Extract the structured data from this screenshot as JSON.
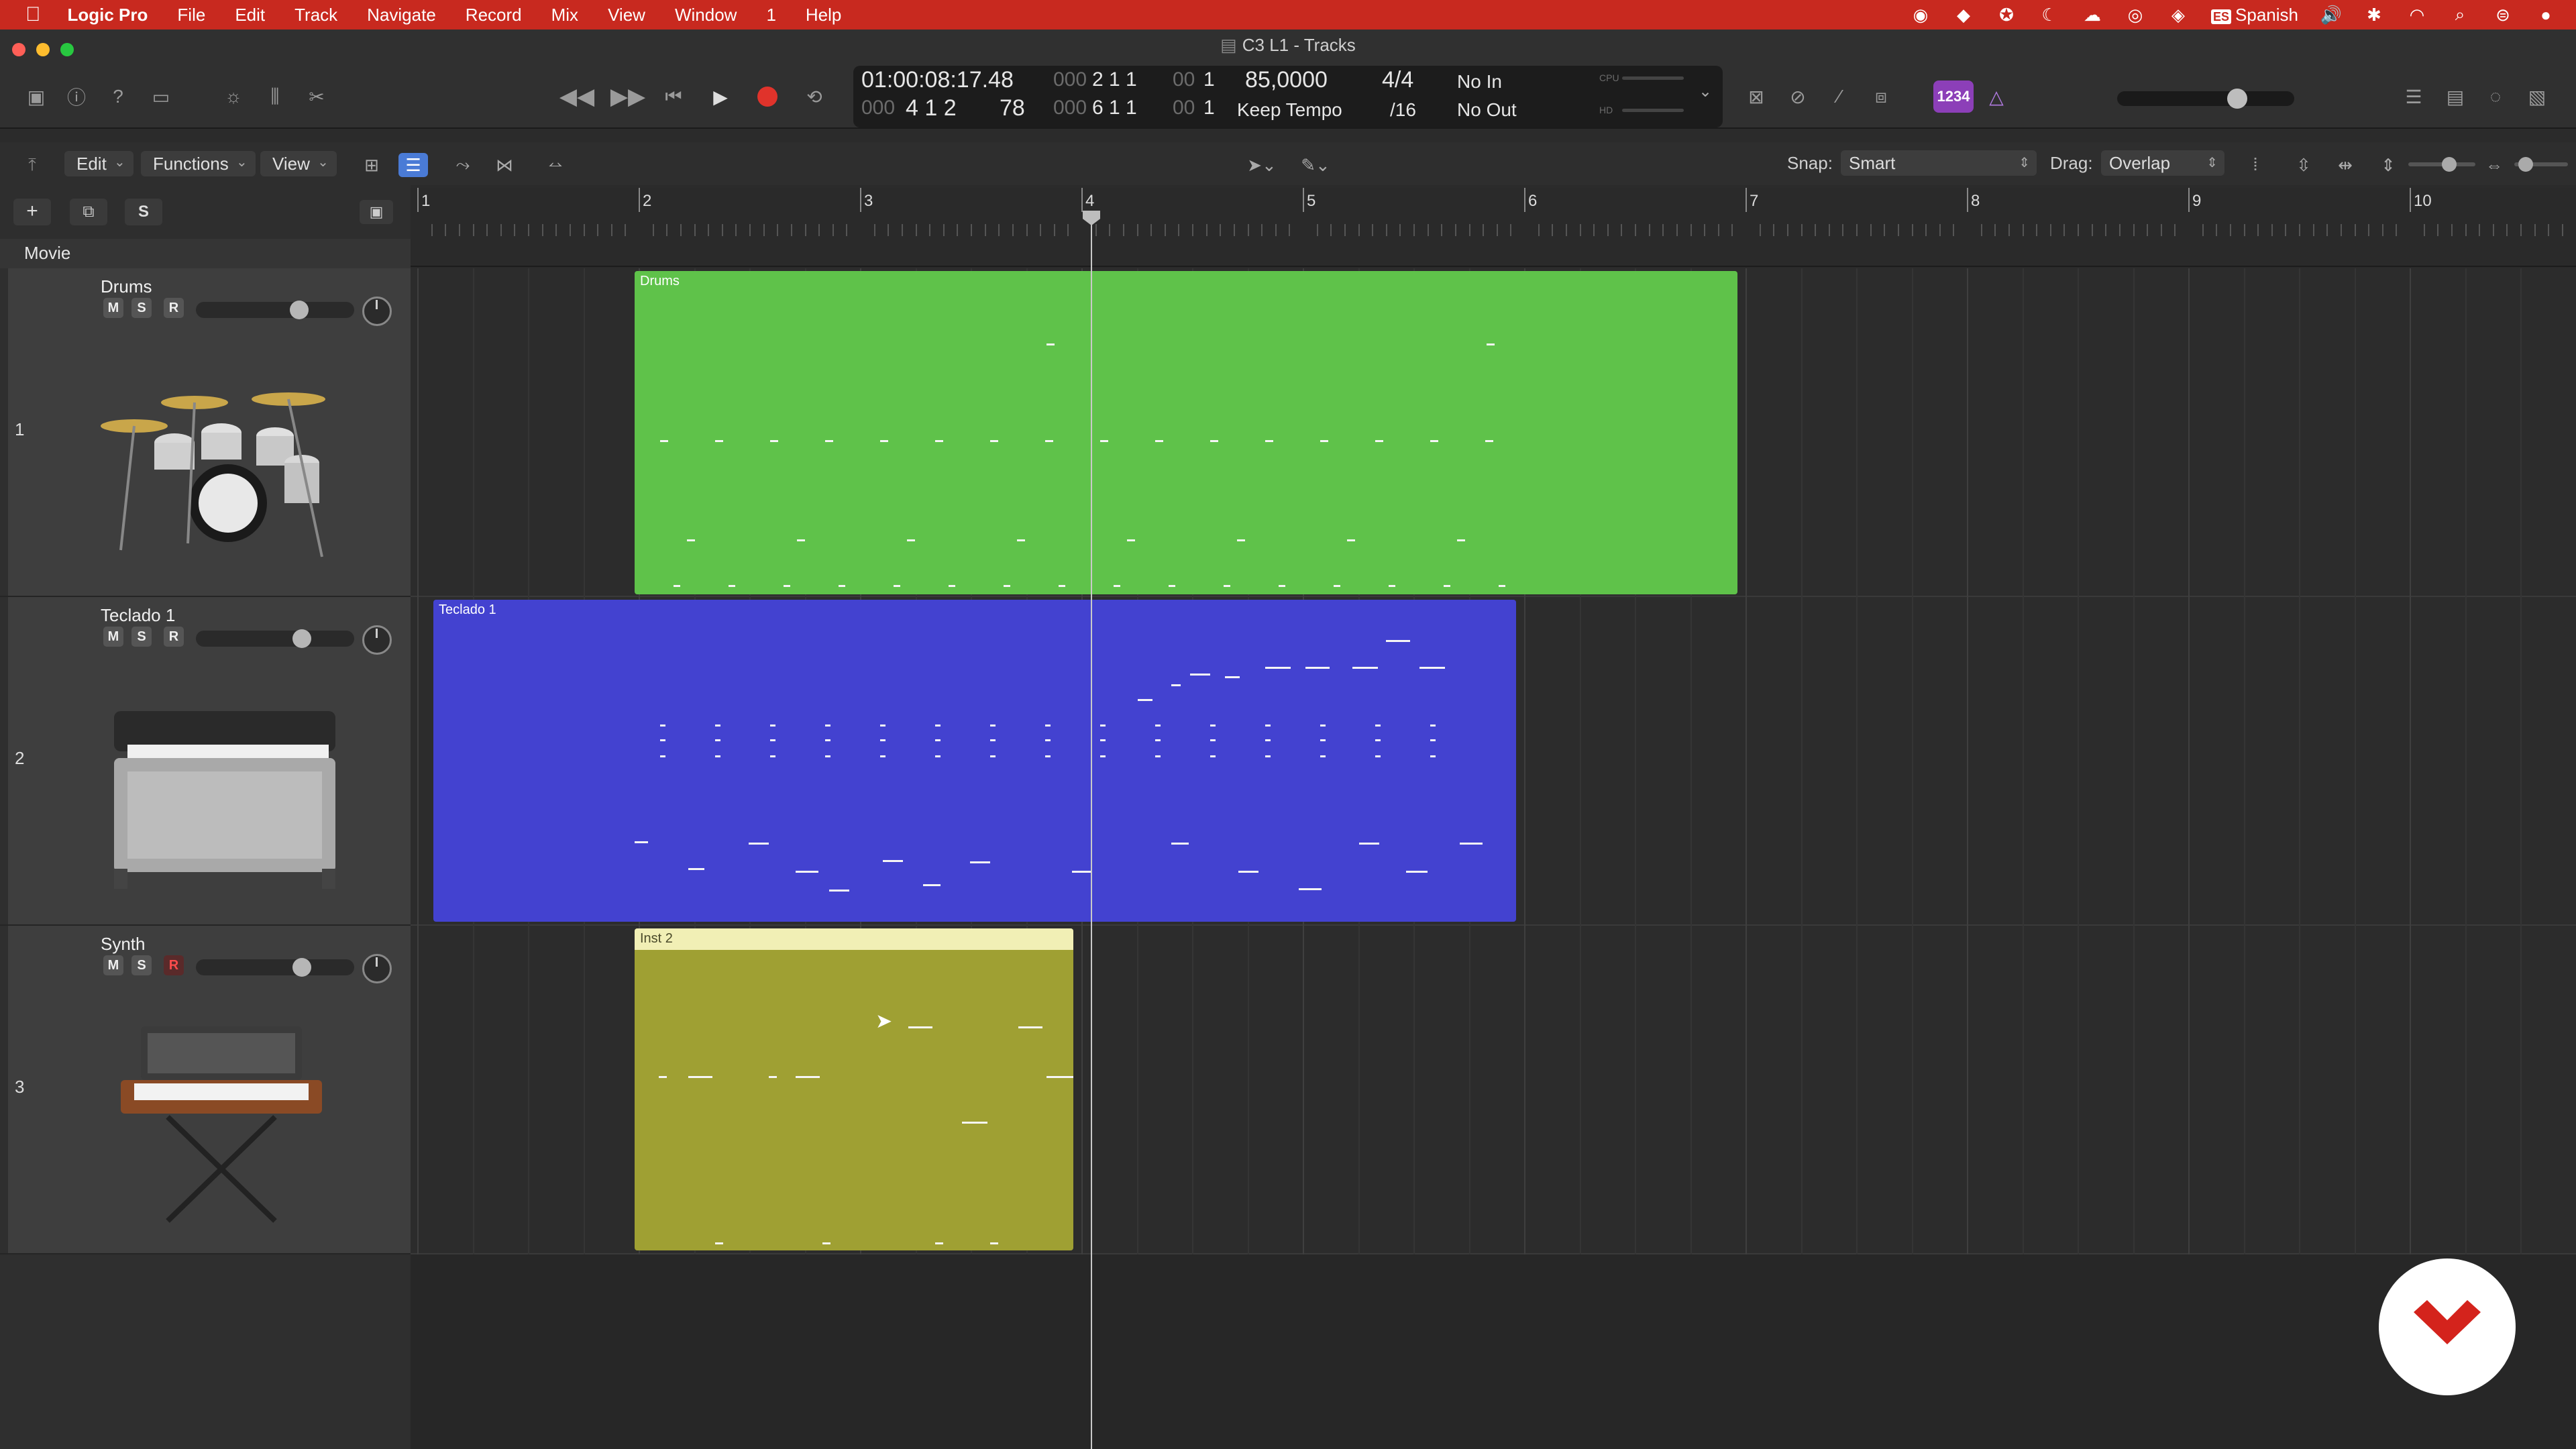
{
  "menubar": {
    "app": "Logic Pro",
    "items": [
      "File",
      "Edit",
      "Track",
      "Navigate",
      "Record",
      "Mix",
      "View",
      "Window",
      "1",
      "Help"
    ],
    "input_source": "Spanish",
    "input_badge": "ES"
  },
  "window": {
    "title": "C3 L1 - Tracks"
  },
  "lcd": {
    "time": "01:00:08:17.48",
    "bar_pos_dim": "000",
    "bar_pos": "2 1 1",
    "bar_pos_dim2": "00",
    "bar_pos_end": "1",
    "pos2": "4 1 2",
    "pos2_dim": "000",
    "pos2_sub": "78",
    "pos3_dim": "000",
    "pos3": "6 1 1",
    "pos3_dim2": "00",
    "pos3_end": "1",
    "tempo": "85,0000",
    "tempo_mode": "Keep Tempo",
    "signature": "4/4",
    "division": "/16",
    "in": "No In",
    "out": "No Out",
    "cpu_label": "CPU",
    "hd_label": "HD"
  },
  "controlbar": {
    "count_in": "1234"
  },
  "toolbar": {
    "edit": "Edit",
    "functions": "Functions",
    "view": "View",
    "snap_label": "Snap:",
    "snap_value": "Smart",
    "drag_label": "Drag:",
    "drag_value": "Overlap"
  },
  "track_list": {
    "add": "+",
    "s_btn": "S",
    "movie": "Movie"
  },
  "ruler": {
    "bars": [
      "1",
      "2",
      "3",
      "4",
      "5",
      "6",
      "7",
      "8",
      "9",
      "10"
    ]
  },
  "tracks": [
    {
      "number": "1",
      "name": "Drums",
      "mute": "M",
      "solo": "S",
      "rec": "R",
      "volume": 0.73,
      "instrument": "drum-kit",
      "region": "Drums",
      "region_color": "#5fc24a"
    },
    {
      "number": "2",
      "name": "Teclado 1",
      "mute": "M",
      "solo": "S",
      "rec": "R",
      "volume": 0.75,
      "instrument": "electric-piano",
      "region": "Teclado 1",
      "region_color": "#4342d0"
    },
    {
      "number": "3",
      "name": "Synth",
      "mute": "M",
      "solo": "S",
      "rec": "R",
      "rec_armed": true,
      "volume": 0.75,
      "instrument": "synthesizer",
      "region": "Inst 2",
      "region_color": "#9fa033"
    }
  ],
  "colors": {
    "menubar": "#c8291f",
    "record": "#e0332b",
    "count_in": "#8c3fb8"
  }
}
